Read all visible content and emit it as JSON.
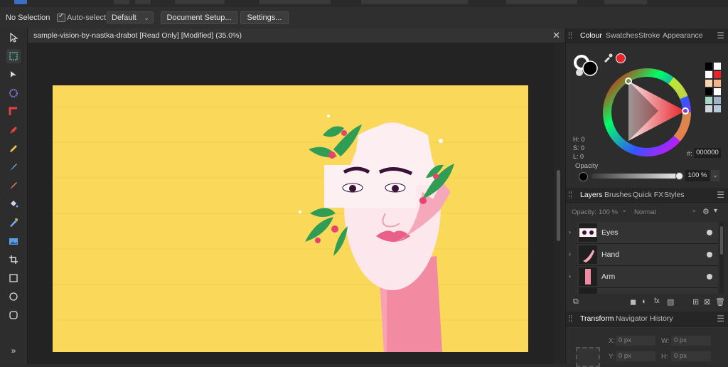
{
  "context_bar": {
    "selection_status": "No Selection",
    "auto_select_label": "Auto-select:",
    "auto_select_value": "Default",
    "document_setup_label": "Document Setup...",
    "settings_label": "Settings..."
  },
  "document": {
    "title": "sample-vision-by-nastka-drabot [Read Only] [Modified] (35.0%)",
    "close_glyph": "✕"
  },
  "colour_panel": {
    "tabs": [
      "Colour",
      "Swatches",
      "Stroke",
      "Appearance"
    ],
    "active_tab": "Colour",
    "h_label": "H: 0",
    "s_label": "S: 0",
    "l_label": "L: 0",
    "hex_value": "000000",
    "hex_prefix": "#:",
    "opacity_label": "Opacity",
    "opacity_value": "100 %",
    "primary_color": "#000000",
    "accent_color": "#e8232a"
  },
  "layers_panel": {
    "tabs": [
      "Layers",
      "Brushes",
      "Quick FX",
      "Styles"
    ],
    "active_tab": "Layers",
    "opacity_label": "Opacity:",
    "opacity_value": "100 %",
    "blend_mode": "Normal",
    "layers": [
      {
        "name": "Eyes"
      },
      {
        "name": "Hand"
      },
      {
        "name": "Arm"
      }
    ]
  },
  "transform_panel": {
    "tabs": [
      "Transform",
      "Navigator",
      "History"
    ],
    "active_tab": "Transform",
    "x_label": "X:",
    "x_value": "0 px",
    "w_label": "W:",
    "w_value": "0 px",
    "y_label": "Y:",
    "y_value": "0 px",
    "h_label": "H:",
    "h_value": "0 px"
  },
  "toolbar": {
    "tools": [
      "move-tool",
      "artboard-tool",
      "node-tool",
      "shape-builder-tool",
      "corner-tool",
      "pen-tool",
      "pencil-tool",
      "vector-brush-tool",
      "paint-brush-tool",
      "fill-tool",
      "transparency-tool",
      "place-image-tool",
      "crop-tool",
      "rectangle-tool",
      "ellipse-tool",
      "rounded-rectangle-tool"
    ],
    "expand_glyph": "»"
  }
}
